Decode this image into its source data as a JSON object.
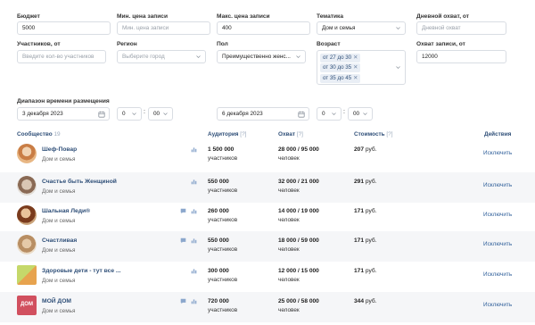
{
  "filters": {
    "budget": {
      "label": "Бюджет",
      "value": "5000"
    },
    "min_price": {
      "label": "Мин. цена записи",
      "placeholder": "Мин. цена записи"
    },
    "max_price": {
      "label": "Макс. цена записи",
      "value": "400"
    },
    "topic": {
      "label": "Тематика",
      "value": "Дом и семья"
    },
    "daily_reach": {
      "label": "Дневной охват, от",
      "placeholder": "Дневной охват"
    },
    "members": {
      "label": "Участников, от",
      "placeholder": "Введите кол-во участников"
    },
    "region": {
      "label": "Регион",
      "placeholder": "Выберите город"
    },
    "gender": {
      "label": "Пол",
      "value": "Преимущественно женс..."
    },
    "age": {
      "label": "Возраст",
      "tags": [
        "от 27 до 30",
        "от 30 до 35",
        "от 35 до 45"
      ]
    },
    "post_reach": {
      "label": "Охват записи, от",
      "value": "12000"
    }
  },
  "date_range": {
    "label": "Диапазон времени размещения",
    "from": {
      "date": "3 декабря 2023",
      "hour": "0",
      "minute": "00"
    },
    "to": {
      "date": "6 декабря 2023",
      "hour": "0",
      "minute": "00"
    }
  },
  "table": {
    "headers": {
      "community": "Сообщество",
      "community_count": "19",
      "audience": "Аудитория",
      "audience_hint": "[?]",
      "reach": "Охват",
      "reach_hint": "[?]",
      "cost": "Стоимость",
      "cost_hint": "[?]",
      "actions": "Действия"
    },
    "rows": [
      {
        "name": "Шеф-Повар",
        "category": "Дом и семья",
        "audience": "1 500 000",
        "audience_unit": "участников",
        "reach": "28 000 / 95 000",
        "reach_unit": "человек",
        "price": "207",
        "currency": "руб.",
        "action": "Исключить",
        "icons": [
          "bar-chart-icon"
        ]
      },
      {
        "name": "Счастье быть Женщиной",
        "category": "Дом и семья",
        "audience": "550 000",
        "audience_unit": "участников",
        "reach": "32 000 / 21 000",
        "reach_unit": "человек",
        "price": "291",
        "currency": "руб.",
        "action": "Исключить",
        "icons": [
          "bar-chart-icon"
        ]
      },
      {
        "name": "Шальная Леди®",
        "category": "Дом и семья",
        "audience": "260 000",
        "audience_unit": "участников",
        "reach": "14 000 / 19 000",
        "reach_unit": "человек",
        "price": "171",
        "currency": "руб.",
        "action": "Исключить",
        "icons": [
          "comment-icon",
          "bar-chart-icon"
        ]
      },
      {
        "name": "Счастливая",
        "category": "Дом и семья",
        "audience": "550 000",
        "audience_unit": "участников",
        "reach": "18 000 / 59 000",
        "reach_unit": "человек",
        "price": "171",
        "currency": "руб.",
        "action": "Исключить",
        "icons": [
          "comment-icon",
          "bar-chart-icon"
        ]
      },
      {
        "name": "Здоровые дети - тут все ...",
        "category": "Дом и семья",
        "audience": "300 000",
        "audience_unit": "участников",
        "reach": "12 000 / 15 000",
        "reach_unit": "человек",
        "price": "171",
        "currency": "руб.",
        "action": "Исключить",
        "icons": [
          "bar-chart-icon"
        ]
      },
      {
        "name": "МОЙ ДОМ",
        "category": "Дом и семья",
        "audience": "720 000",
        "audience_unit": "участников",
        "reach": "25 000 / 58 000",
        "reach_unit": "человек",
        "price": "344",
        "currency": "руб.",
        "action": "Исключить",
        "icons": [
          "comment-icon",
          "bar-chart-icon"
        ],
        "avatar_text": "ДОМ"
      }
    ]
  },
  "colors": {
    "accent": "#2f4f78",
    "link": "#2f5f9a",
    "tag_bg": "#e9eef5",
    "row_alt": "#f5f6f8"
  }
}
